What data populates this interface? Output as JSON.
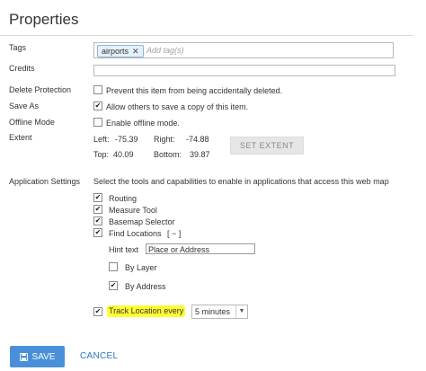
{
  "panel": {
    "title": "Properties"
  },
  "tags": {
    "label": "Tags",
    "chips": [
      "airports"
    ],
    "placeholder": "Add tag(s)"
  },
  "credits": {
    "label": "Credits",
    "value": ""
  },
  "delete_protection": {
    "label": "Delete Protection",
    "checked": false,
    "text": "Prevent this item from being accidentally deleted."
  },
  "save_as": {
    "label": "Save As",
    "checked": true,
    "text": "Allow others to save a copy of this item."
  },
  "offline_mode": {
    "label": "Offline Mode",
    "checked": false,
    "text": "Enable offline mode."
  },
  "extent": {
    "label": "Extent",
    "left_label": "Left:",
    "left_value": "-75.39",
    "right_label": "Right:",
    "right_value": "-74.88",
    "top_label": "Top:",
    "top_value": "40.09",
    "bottom_label": "Bottom:",
    "bottom_value": "39.87",
    "button": "SET EXTENT"
  },
  "app_settings": {
    "label": "Application Settings",
    "description": "Select the tools and capabilities to enable in applications that access this web map",
    "routing": {
      "text": "Routing",
      "checked": true
    },
    "measure_tool": {
      "text": "Measure Tool",
      "checked": true
    },
    "basemap_selector": {
      "text": "Basemap Selector",
      "checked": true
    },
    "find_locations": {
      "text": "Find Locations",
      "toggle": "[ − ]",
      "checked": true
    },
    "hint_text": {
      "label": "Hint text",
      "value": "Place or Address"
    },
    "by_layer": {
      "text": "By Layer",
      "checked": false
    },
    "by_address": {
      "text": "By Address",
      "checked": true
    },
    "track_location": {
      "text": "Track Location every",
      "checked": true,
      "interval": "5 minutes",
      "highlight_color": "#ffff33"
    }
  },
  "footer": {
    "save": "SAVE",
    "cancel": "CANCEL",
    "save_color": "#4a90d9",
    "cancel_color": "#2f74c0"
  }
}
